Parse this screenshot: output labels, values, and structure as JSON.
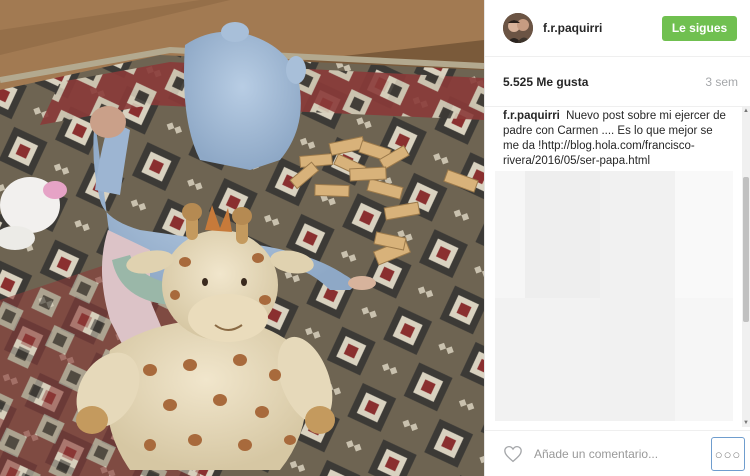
{
  "post": {
    "image_alt": "Bebé con capucha azul jugando con fichas de dominó sobre una alfombra junto a un peluche de jirafa"
  },
  "header": {
    "username": "f.r.paquirri",
    "follow_label": "Le sigues"
  },
  "stats": {
    "likes": "5.525 Me gusta",
    "time": "3 sem"
  },
  "caption": {
    "user": "f.r.paquirri",
    "text": "Nuevo post sobre mi ejercer de padre con Carmen .... Es lo que mejor se me da !http://blog.hola.com/francisco-rivera/2016/05/ser-papa.html"
  },
  "footer": {
    "comment_placeholder": "Añade un comentario...",
    "more_label": "○○○"
  },
  "icons": {
    "like": "heart-icon",
    "more": "more-options-icon"
  },
  "colors": {
    "follow_button": "#70c050",
    "time_text": "#a5a7aa",
    "focus_border": "#6f9dce"
  }
}
